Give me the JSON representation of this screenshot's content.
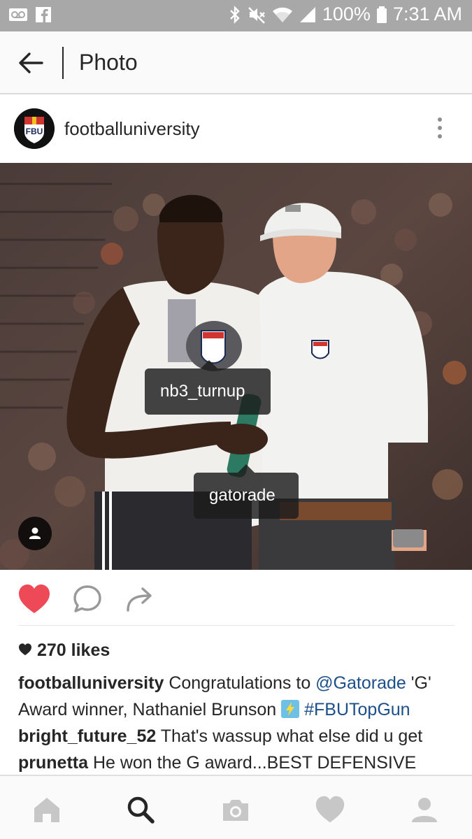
{
  "status_bar": {
    "battery": "100%",
    "time": "7:31 AM",
    "icons": [
      "voicemail-icon",
      "facebook-icon",
      "bluetooth-icon",
      "mute-icon",
      "wifi-icon",
      "signal-icon",
      "battery-icon"
    ]
  },
  "header": {
    "title": "Photo",
    "back_icon": "arrow-left-icon"
  },
  "post": {
    "username": "footballuniversity",
    "avatar_text": "FBU",
    "more_icon": "more-vertical-icon",
    "photo_tags": [
      "nb3_turnup",
      "gatorade"
    ],
    "likes_count": "270 likes",
    "caption": {
      "user": "footballuniversity",
      "text_before": " Congratulations to ",
      "mention": "@Gatorade",
      "text_middle": " 'G' Award winner, Nathaniel Brunson ",
      "hashtag": "#FBUTopGun"
    },
    "comments": [
      {
        "user": "bright_future_52",
        "text": " That's wassup what else did u get"
      },
      {
        "user": "prunetta",
        "text": " He won the G award...BEST DEFENSIVE LINE"
      }
    ]
  },
  "actions": {
    "like_icon": "heart-filled-icon",
    "comment_icon": "comment-bubble-icon",
    "share_icon": "share-arrow-icon",
    "like_color": "#ed4956"
  },
  "bottom_nav": [
    "home-icon",
    "search-icon",
    "camera-icon",
    "heart-icon",
    "profile-icon"
  ]
}
